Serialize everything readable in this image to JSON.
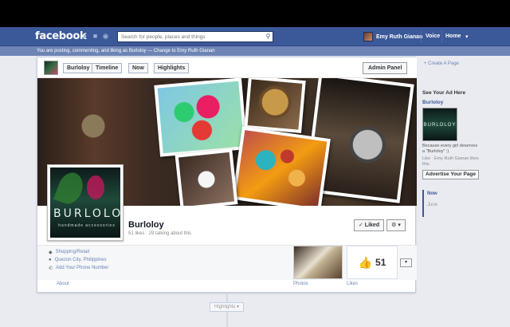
{
  "topbar": {
    "logo": "facebook",
    "search_placeholder": "Search for people, places and things",
    "user_name": "Emy Ruth Gianan",
    "nav": [
      "Voice",
      "Home"
    ]
  },
  "posting": {
    "prefix": "You are posting, commenting, and liking as Burloloy —",
    "link": "Change to Emy Ruth Gianan"
  },
  "pagebar": {
    "buttons": [
      "Burloloy",
      "Timeline",
      "Now",
      "Highlights"
    ],
    "admin_panel": "Admin Panel"
  },
  "profile": {
    "pic_text": "BURLOLOY",
    "pic_subtext": "handmade accessories",
    "name": "Burloloy",
    "stats": "51 likes · 29 talking about this",
    "liked_button": "✓ Liked",
    "gear_button": "⚙ ▾"
  },
  "info": {
    "category": "Shopping/Retail",
    "location": "Quezon City, Philippines",
    "phone": "Add Your Phone Number",
    "about": "About",
    "photos": "Photos",
    "likes": "Likes",
    "likes_count": "51"
  },
  "timeline": {
    "highlights": "Highlights ▾"
  },
  "sidebar": {
    "create_page": "+ Create A Page",
    "ad_heading": "See Your Ad Here",
    "ad_title": "Burloloy",
    "ad_image_text": "BURLOLOY",
    "ad_body": "Because every girl deserves a \"Burloloy\" :)",
    "ad_like": "Like · Emy Ruth Gianan likes this.",
    "advertise_button": "Advertise Your Page",
    "scrub_now": "Now",
    "scrub_june": "June"
  },
  "colors": {
    "brand_blue": "#3b5998",
    "posting_bar": "#6d84b4"
  }
}
